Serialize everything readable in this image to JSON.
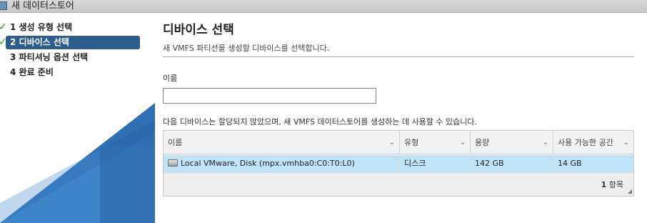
{
  "window": {
    "title": "새 데이터스토어"
  },
  "steps": [
    {
      "label": "1 생성 유형 선택",
      "done": true
    },
    {
      "label": "2 디바이스 선택",
      "done": true,
      "active": true
    },
    {
      "label": "3 파티셔닝 옵션 선택",
      "done": false
    },
    {
      "label": "4 완료 준비",
      "done": false
    }
  ],
  "page": {
    "title": "디바이스 선택",
    "subtitle": "새 VMFS 파티션을 생성할 디바이스를 선택합니다.",
    "name_label": "이름",
    "name_value": "",
    "instruction": "다음 디바이스는 할당되지 않았으며, 새 VMFS 데이터스토어를 생성하는 데 사용할 수 있습니다."
  },
  "grid": {
    "columns": [
      "이름",
      "유형",
      "용량",
      "사용 가능한 공간"
    ],
    "rows": [
      {
        "name": "Local VMware, Disk (mpx.vmhba0:C0:T0:L0)",
        "type": "디스크",
        "capacity": "142 GB",
        "free": "14 GB"
      }
    ],
    "footer_count": "1",
    "footer_unit": "항목"
  },
  "colors": {
    "selected_step": "#2d5c8e",
    "selected_row": "#bfe3f7",
    "check": "#2e9e3c",
    "accent_blue": "#2f6fb5"
  }
}
